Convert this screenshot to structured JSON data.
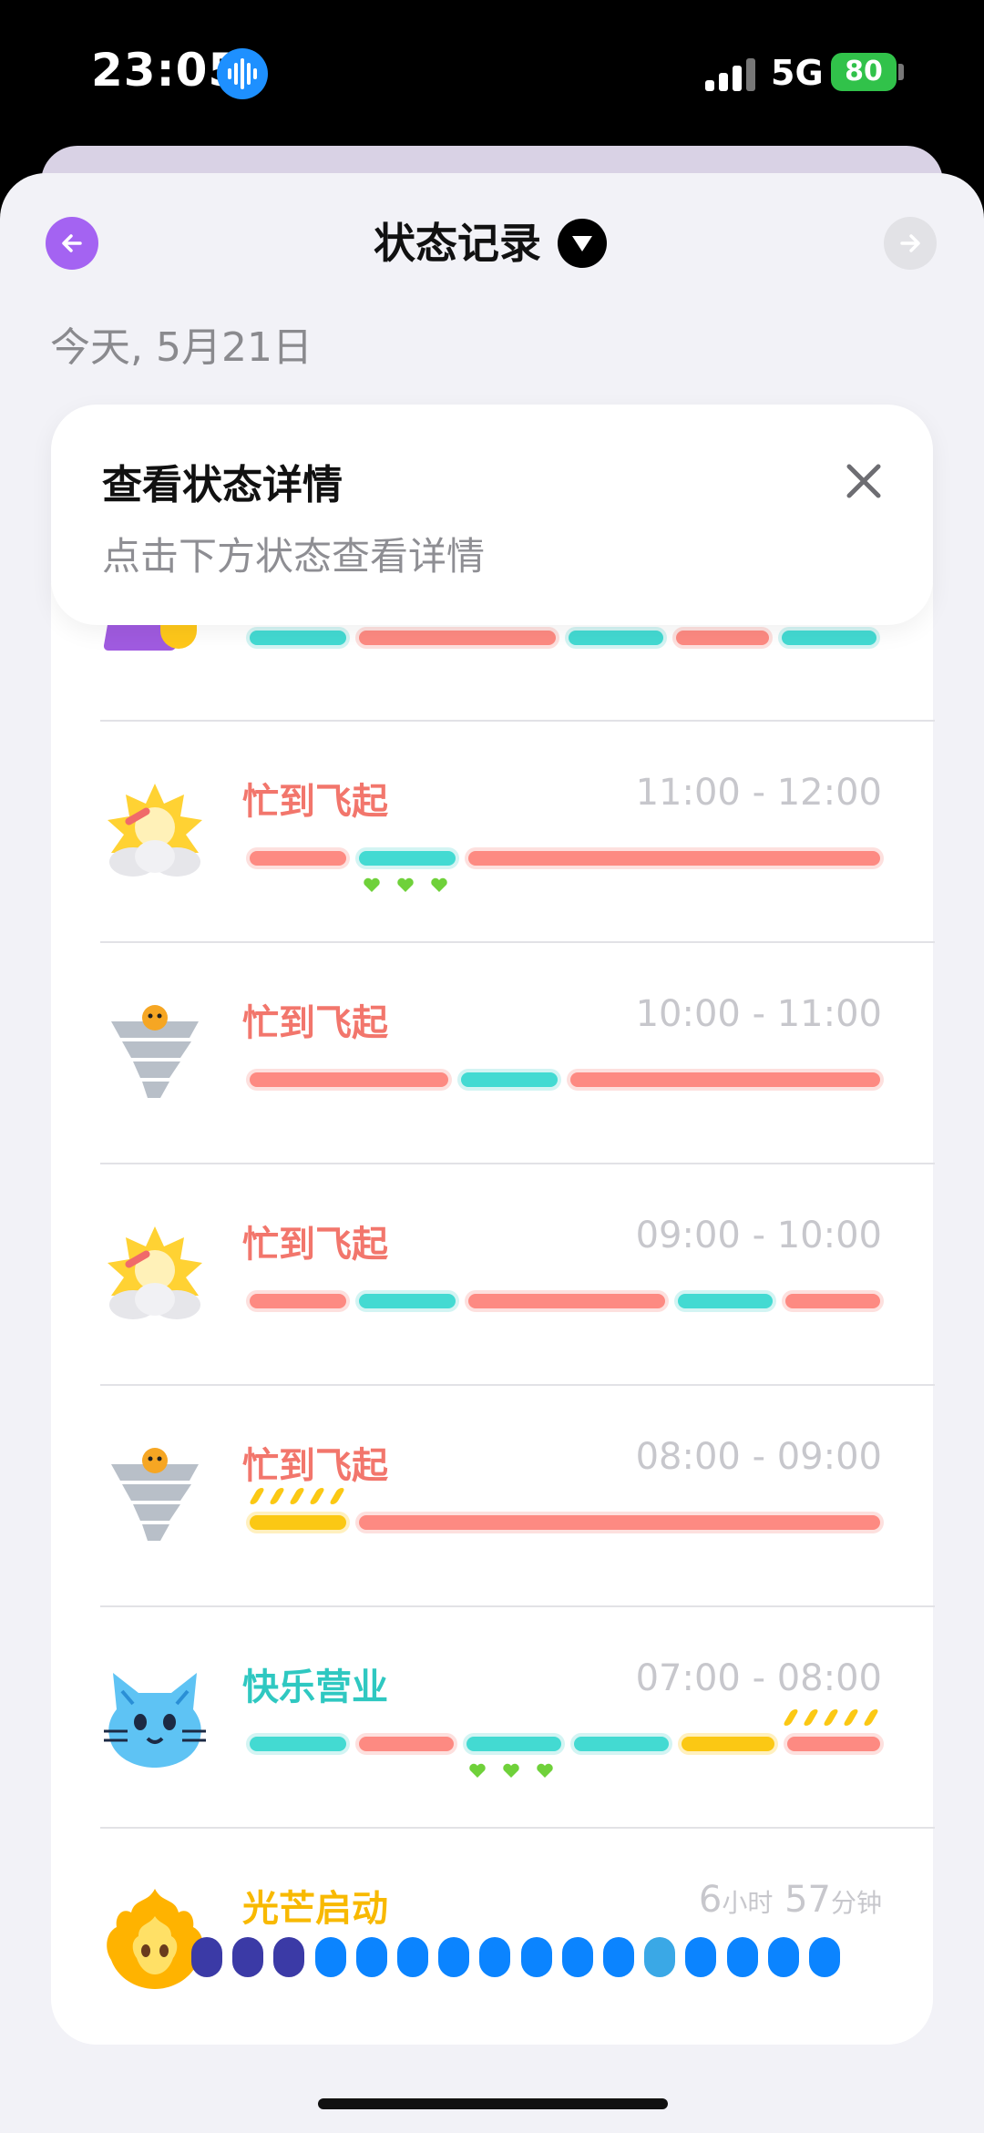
{
  "status_bar": {
    "time": "23:05",
    "network": "5G",
    "battery": "80"
  },
  "header": {
    "title": "状态记录",
    "date": "今天, 5月21日"
  },
  "tooltip": {
    "title": "查看状态详情",
    "subtitle": "点击下方状态查看详情"
  },
  "colors": {
    "accent": "#a463f2",
    "busy": "#f2766c",
    "happy": "#2fc8c1",
    "glow": "#f8b900"
  },
  "records": [
    {
      "title": "忙到飞起",
      "time": "11:00 - 12:00",
      "icon": "sun-cloud-icon",
      "bars": [
        "red",
        "teal",
        "red"
      ],
      "hearts": true
    },
    {
      "title": "忙到飞起",
      "time": "10:00 - 11:00",
      "icon": "tornado-icon",
      "bars": [
        "red",
        "teal",
        "red"
      ],
      "hearts": false
    },
    {
      "title": "忙到飞起",
      "time": "09:00 - 10:00",
      "icon": "sun-cloud-icon",
      "bars": [
        "red",
        "teal",
        "red",
        "teal",
        "red"
      ],
      "hearts": false
    },
    {
      "title": "忙到飞起",
      "time": "08:00 - 09:00",
      "icon": "tornado-icon",
      "bars": [
        "yellow",
        "red"
      ],
      "hearts": false
    },
    {
      "title": "快乐营业",
      "time": "07:00 - 08:00",
      "icon": "cat-icon",
      "bars": [
        "teal",
        "red",
        "teal",
        "teal",
        "yellow",
        "red"
      ],
      "hearts": true
    }
  ],
  "summary": {
    "title": "光芒启动",
    "hours": "6",
    "hours_unit": "小时",
    "minutes": "57",
    "minutes_unit": "分钟",
    "icon": "flame-icon",
    "dots": [
      "#3b3aa6",
      "#3b3aa6",
      "#3b3aa6",
      "#0b84ff",
      "#0b84ff",
      "#0b84ff",
      "#0b84ff",
      "#0b84ff",
      "#0b84ff",
      "#0b84ff",
      "#0b84ff",
      "#3aa8e6",
      "#0b84ff",
      "#0b84ff",
      "#0b84ff",
      "#0b84ff"
    ]
  }
}
